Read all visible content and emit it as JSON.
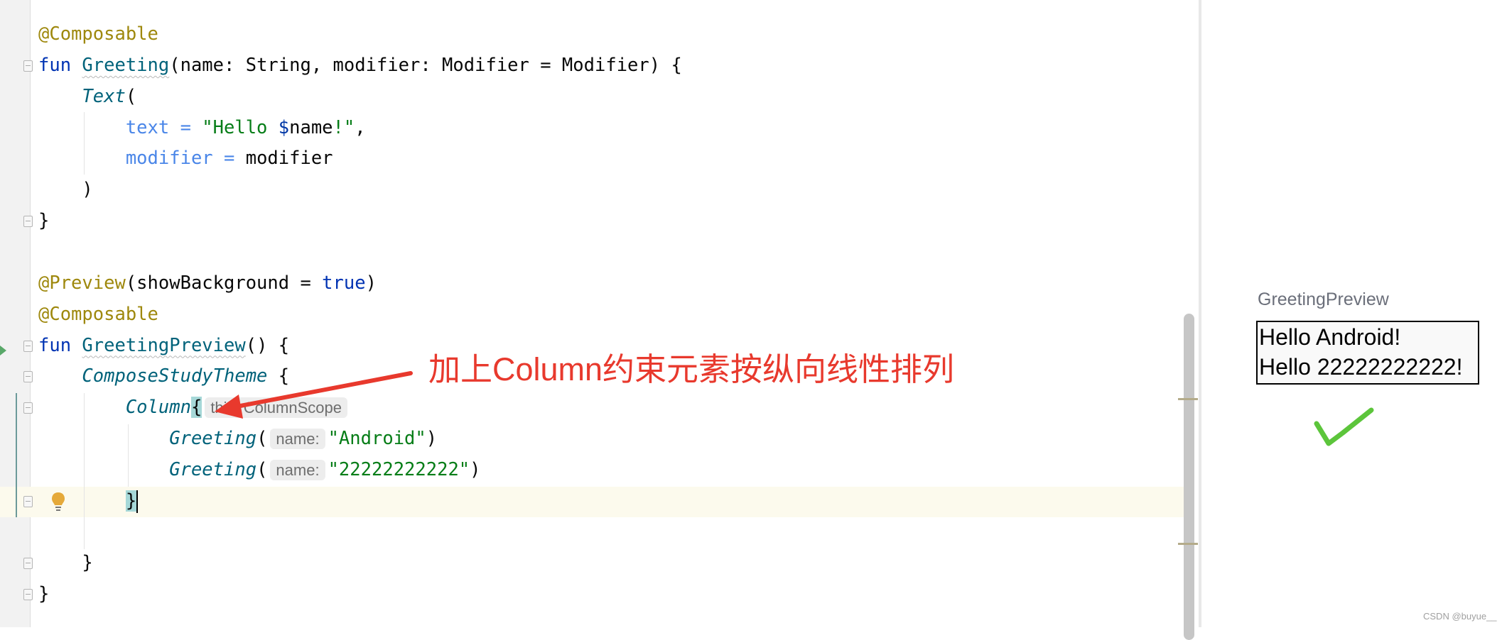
{
  "editor": {
    "lines": [
      [
        {
          "t": "@Composable",
          "c": "ann"
        }
      ],
      [
        {
          "t": "fun ",
          "c": "kw"
        },
        {
          "t": "Greeting",
          "c": "fn-wavy"
        },
        {
          "t": "(name: String, modifier: Modifier = Modifier) {",
          "c": ""
        }
      ],
      [
        {
          "t": "    ",
          "c": ""
        },
        {
          "t": "Text",
          "c": "call"
        },
        {
          "t": "(",
          "c": ""
        }
      ],
      [
        {
          "t": "        ",
          "c": ""
        },
        {
          "t": "text = ",
          "c": "param"
        },
        {
          "t": "\"Hello ",
          "c": "str"
        },
        {
          "t": "$",
          "c": "dollar"
        },
        {
          "t": "name",
          "c": ""
        },
        {
          "t": "!\"",
          "c": "str"
        },
        {
          "t": ",",
          "c": ""
        }
      ],
      [
        {
          "t": "        ",
          "c": ""
        },
        {
          "t": "modifier = ",
          "c": "param"
        },
        {
          "t": "modifier",
          "c": ""
        }
      ],
      [
        {
          "t": "    )",
          "c": ""
        }
      ],
      [
        {
          "t": "}",
          "c": ""
        }
      ],
      [],
      [
        {
          "t": "@Preview",
          "c": "ann"
        },
        {
          "t": "(showBackground = ",
          "c": ""
        },
        {
          "t": "true",
          "c": "kw"
        },
        {
          "t": ")",
          "c": ""
        }
      ],
      [
        {
          "t": "@Composable",
          "c": "ann"
        }
      ],
      [
        {
          "t": "fun ",
          "c": "kw"
        },
        {
          "t": "GreetingPreview",
          "c": "fn-wavy"
        },
        {
          "t": "() {",
          "c": ""
        }
      ],
      [
        {
          "t": "    ",
          "c": ""
        },
        {
          "t": "ComposeStudyTheme",
          "c": "call"
        },
        {
          "t": " {",
          "c": ""
        }
      ],
      [
        {
          "t": "        ",
          "c": ""
        },
        {
          "t": "Column",
          "c": "call"
        },
        {
          "t": "{",
          "c": "brace-hl"
        },
        {
          "t": "this: ColumnScope",
          "c": "hint"
        }
      ],
      [
        {
          "t": "            ",
          "c": ""
        },
        {
          "t": "Greeting",
          "c": "call"
        },
        {
          "t": "(",
          "c": ""
        },
        {
          "t": "name:",
          "c": "hint"
        },
        {
          "t": "\"Android\"",
          "c": "str"
        },
        {
          "t": ")",
          "c": ""
        }
      ],
      [
        {
          "t": "            ",
          "c": ""
        },
        {
          "t": "Greeting",
          "c": "call"
        },
        {
          "t": "(",
          "c": ""
        },
        {
          "t": "name:",
          "c": "hint"
        },
        {
          "t": "\"22222222222\"",
          "c": "str"
        },
        {
          "t": ")",
          "c": ""
        }
      ],
      [
        {
          "t": "        ",
          "c": ""
        },
        {
          "t": "}",
          "c": "brace-hl"
        }
      ],
      [],
      [
        {
          "t": "    }",
          "c": ""
        }
      ],
      [
        {
          "t": "}",
          "c": ""
        }
      ]
    ]
  },
  "annotation": {
    "text": "加上Column约束元素按纵向线性排列",
    "color": "#e8392d"
  },
  "preview": {
    "title": "GreetingPreview",
    "lines": [
      "Hello Android!",
      "Hello 22222222222!"
    ],
    "status_icon": "checkmark-icon",
    "status_color": "#5cc53b"
  },
  "watermark": "CSDN @buyue__"
}
